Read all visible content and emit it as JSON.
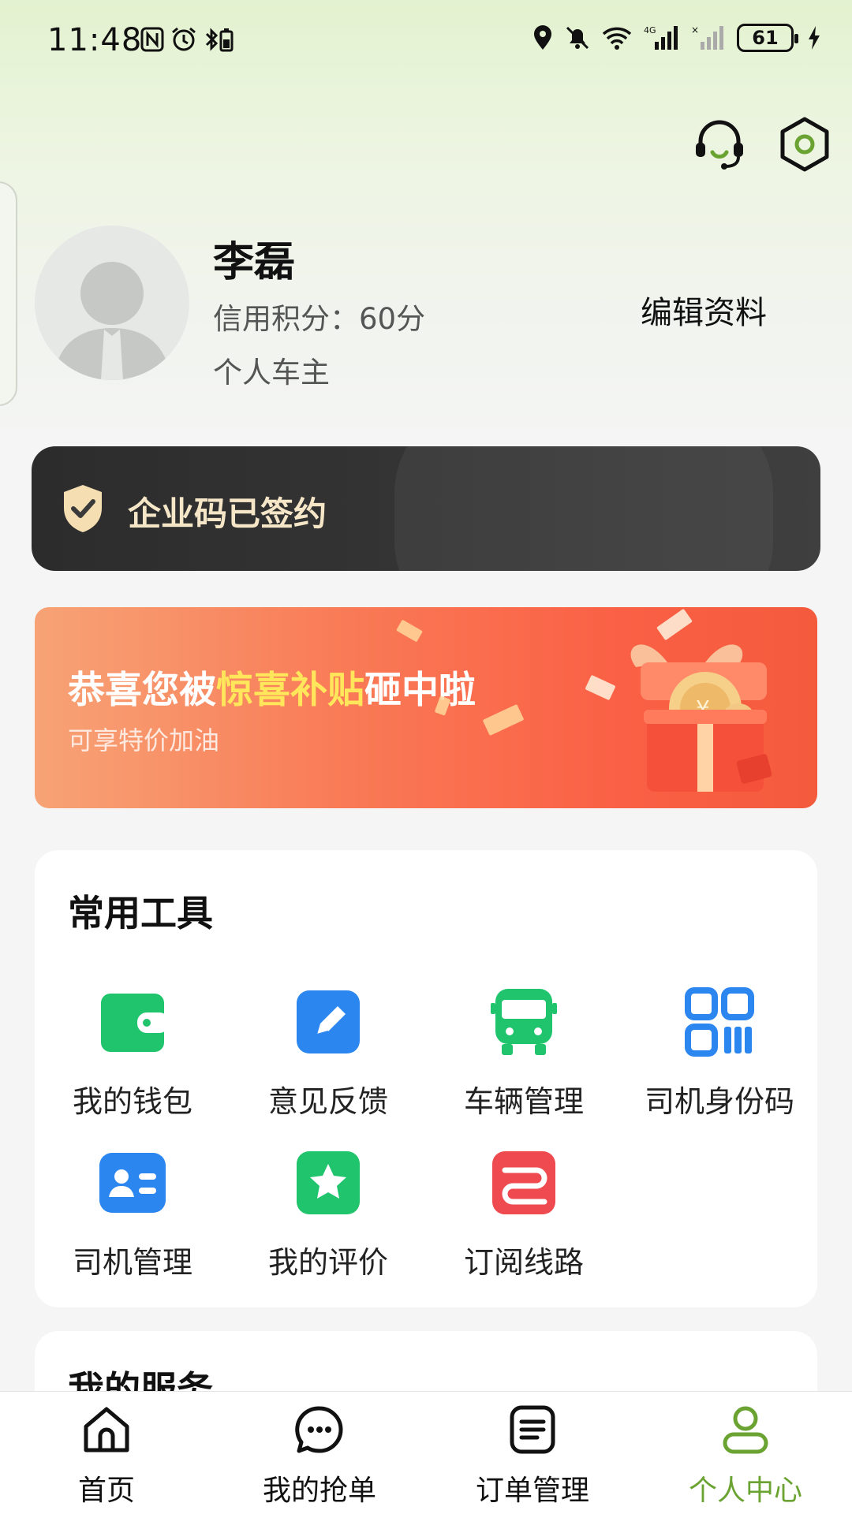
{
  "status_bar": {
    "time": "11:48",
    "battery": "61",
    "network": "4G"
  },
  "header": {
    "support_icon": "headset-icon",
    "settings_icon": "settings-hexagon-icon"
  },
  "profile": {
    "name": "李磊",
    "credit": "信用积分：60分",
    "role": "个人车主",
    "edit_label": "编辑资料"
  },
  "enterprise": {
    "text": "企业码已签约",
    "icon": "shield-check-icon",
    "accent": "#f5e6c8"
  },
  "banner": {
    "title_prefix": "恭喜您被",
    "title_highlight": "惊喜补贴",
    "title_suffix": "砸中啦",
    "subtitle": "可享特价加油",
    "highlight_color": "#ffe65a"
  },
  "tools": {
    "title": "常用工具",
    "items": [
      {
        "label": "我的钱包",
        "icon": "wallet-icon",
        "color": "#1fc46d"
      },
      {
        "label": "意见反馈",
        "icon": "edit-feedback-icon",
        "color": "#2b86f0"
      },
      {
        "label": "车辆管理",
        "icon": "bus-icon",
        "color": "#1fc46d"
      },
      {
        "label": "司机身份码",
        "icon": "qr-code-icon",
        "color": "#2b86f0"
      },
      {
        "label": "司机管理",
        "icon": "id-card-icon",
        "color": "#2b86f0"
      },
      {
        "label": "我的评价",
        "icon": "star-icon",
        "color": "#1fc46d"
      },
      {
        "label": "订阅线路",
        "icon": "route-icon",
        "color": "#ef4a4f"
      }
    ]
  },
  "services": {
    "title": "我的服务"
  },
  "bottom_nav": {
    "active_color": "#6aa332",
    "items": [
      {
        "label": "首页",
        "icon": "home-icon"
      },
      {
        "label": "我的抢单",
        "icon": "chat-bubble-icon"
      },
      {
        "label": "订单管理",
        "icon": "document-list-icon"
      },
      {
        "label": "个人中心",
        "icon": "user-icon",
        "active": true
      }
    ]
  }
}
